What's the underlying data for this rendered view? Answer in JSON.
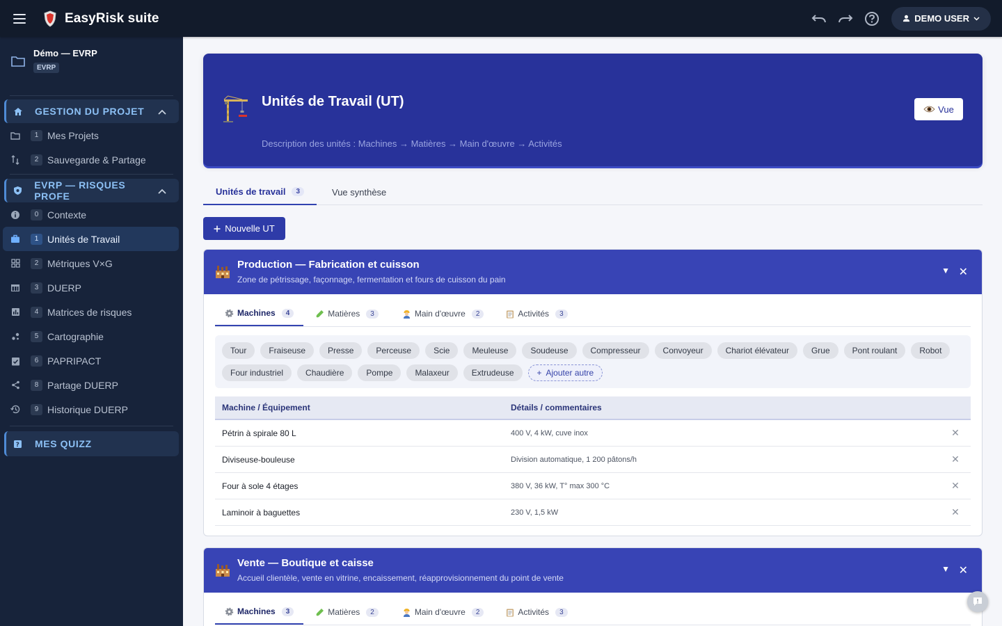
{
  "app": {
    "title": "EasyRisk suite",
    "user": "DEMO USER"
  },
  "sidebar": {
    "project_name": "Démo — EVRP",
    "project_badge": "EVRP",
    "sections": [
      {
        "label": "GESTION DU PROJET",
        "items": [
          {
            "num": "1",
            "label": "Mes Projets"
          },
          {
            "num": "2",
            "label": "Sauvegarde & Partage"
          }
        ]
      },
      {
        "label": "EVRP — RISQUES PROFE",
        "items": [
          {
            "num": "0",
            "label": "Contexte"
          },
          {
            "num": "1",
            "label": "Unités de Travail"
          },
          {
            "num": "2",
            "label": "Métriques V×G"
          },
          {
            "num": "3",
            "label": "DUERP"
          },
          {
            "num": "4",
            "label": "Matrices de risques"
          },
          {
            "num": "5",
            "label": "Cartographie"
          },
          {
            "num": "6",
            "label": "PAPRIPACT"
          },
          {
            "num": "8",
            "label": "Partage DUERP"
          },
          {
            "num": "9",
            "label": "Historique DUERP"
          }
        ]
      },
      {
        "label": "MES QUIZZ"
      }
    ]
  },
  "hero": {
    "title": "Unités de Travail (UT)",
    "subtitle": "Description des unités : Machines → Matières → Main d'œuvre → Activités",
    "view_button": "Vue"
  },
  "tabs": [
    {
      "label": "Unités de travail",
      "count": "3"
    },
    {
      "label": "Vue synthèse"
    }
  ],
  "new_button": "Nouvelle UT",
  "units": [
    {
      "title": "Production — Fabrication et cuisson",
      "subtitle": "Zone de pétrissage, façonnage, fermentation et fours de cuisson du pain",
      "tabs": [
        {
          "label": "Machines",
          "count": "4"
        },
        {
          "label": "Matières",
          "count": "3"
        },
        {
          "label": "Main d'œuvre",
          "count": "2"
        },
        {
          "label": "Activités",
          "count": "3"
        }
      ],
      "chips": [
        "Tour",
        "Fraiseuse",
        "Presse",
        "Perceuse",
        "Scie",
        "Meuleuse",
        "Soudeuse",
        "Compresseur",
        "Convoyeur",
        "Chariot élévateur",
        "Grue",
        "Pont roulant",
        "Robot",
        "Four industriel",
        "Chaudière",
        "Pompe",
        "Malaxeur",
        "Extrudeuse"
      ],
      "add_chip": "Ajouter autre",
      "columns": [
        "Machine / Équipement",
        "Détails / commentaires"
      ],
      "rows": [
        [
          "Pétrin à spirale 80 L",
          "400 V, 4 kW, cuve inox"
        ],
        [
          "Diviseuse-bouleuse",
          "Division automatique, 1 200 pâtons/h"
        ],
        [
          "Four à sole 4 étages",
          "380 V, 36 kW, T° max 300 °C"
        ],
        [
          "Laminoir à baguettes",
          "230 V, 1,5 kW"
        ]
      ]
    },
    {
      "title": "Vente — Boutique et caisse",
      "subtitle": "Accueil clientèle, vente en vitrine, encaissement, réapprovisionnement du point de vente",
      "tabs": [
        {
          "label": "Machines",
          "count": "3"
        },
        {
          "label": "Matières",
          "count": "2"
        },
        {
          "label": "Main d'œuvre",
          "count": "2"
        },
        {
          "label": "Activités",
          "count": "3"
        }
      ]
    }
  ],
  "colors": {
    "topbar": "#121b2b",
    "sidebar": "#17233a",
    "hero": "#28329a",
    "card_head": "#3844b5",
    "accent": "#2e3ba8"
  }
}
